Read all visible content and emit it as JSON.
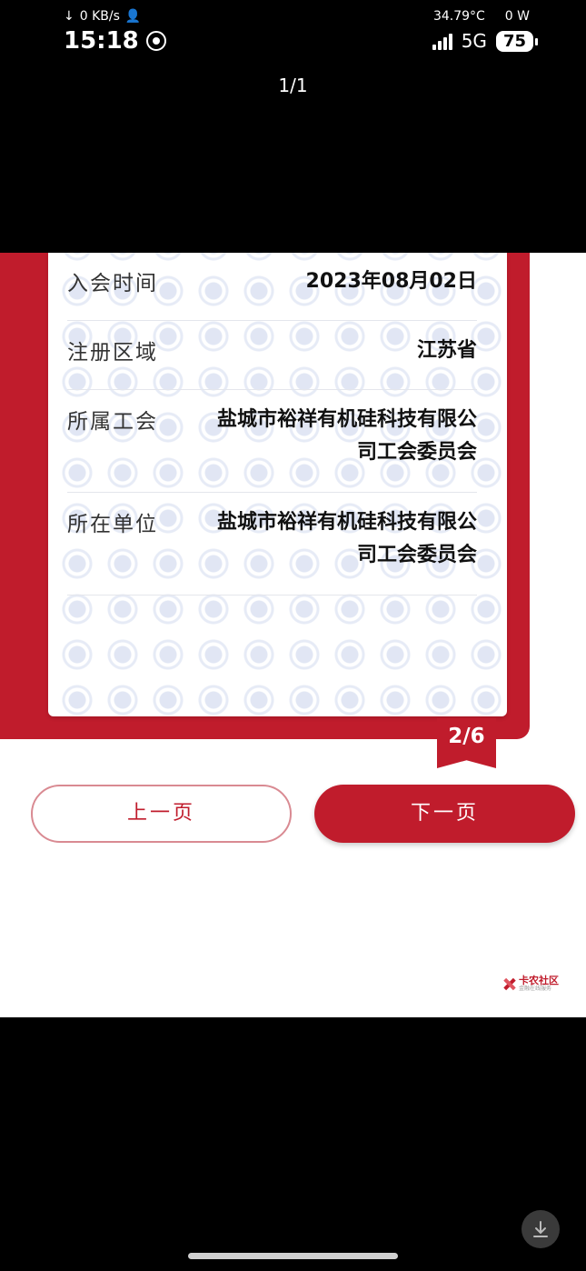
{
  "status_bar": {
    "net_speed": "0 KB/s",
    "time": "15:18",
    "temperature": "34.79°C",
    "power": "0 W",
    "network": "5G",
    "battery": "75"
  },
  "viewer": {
    "page_counter": "1/1"
  },
  "card": {
    "rows": [
      {
        "label": "入会时间",
        "value": "2023年08月02日"
      },
      {
        "label": "注册区域",
        "value": "江苏省"
      },
      {
        "label": "所属工会",
        "value": "盐城市裕祥有机硅科技有限公司工会委员会"
      },
      {
        "label": "所在单位",
        "value": "盐城市裕祥有机硅科技有限公司工会委员会"
      }
    ],
    "page_badge": "2/6"
  },
  "buttons": {
    "prev": "上一页",
    "next": "下一页"
  },
  "watermark": {
    "text": "卡农社区",
    "sub": "金融在线服务"
  },
  "colors": {
    "accent": "#c01c2c",
    "background": "#000000",
    "card": "#ffffff"
  },
  "icons": {
    "download": "download-arrow-icon"
  }
}
